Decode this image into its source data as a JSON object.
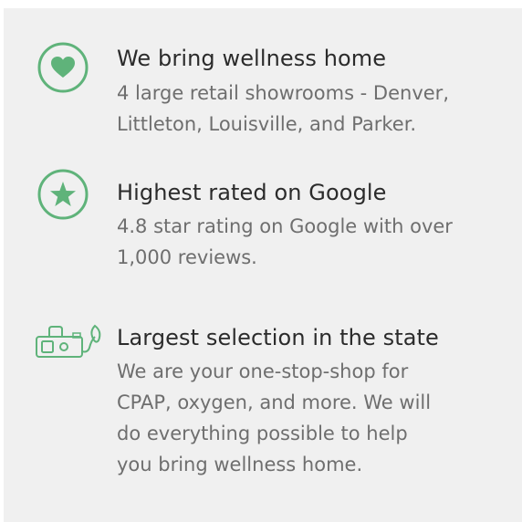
{
  "colors": {
    "accent": "#5fb37a",
    "panel_bg": "#f0f0f0",
    "title": "#2b2b2b",
    "desc": "#6e6e6e"
  },
  "features": [
    {
      "icon": "heart-icon",
      "title": "We bring wellness home",
      "desc": "4 large retail showrooms - Denver,\nLittleton, Louisville, and Parker."
    },
    {
      "icon": "star-icon",
      "title": "Highest rated on Google",
      "desc": "4.8 star rating on Google with over\n1,000 reviews."
    },
    {
      "icon": "cpap-oxygen-icon",
      "title": "Largest selection in the state",
      "desc": "We are your one-stop-shop for\nCPAP, oxygen, and more. We will\ndo everything possible to help\nyou bring wellness home."
    }
  ]
}
